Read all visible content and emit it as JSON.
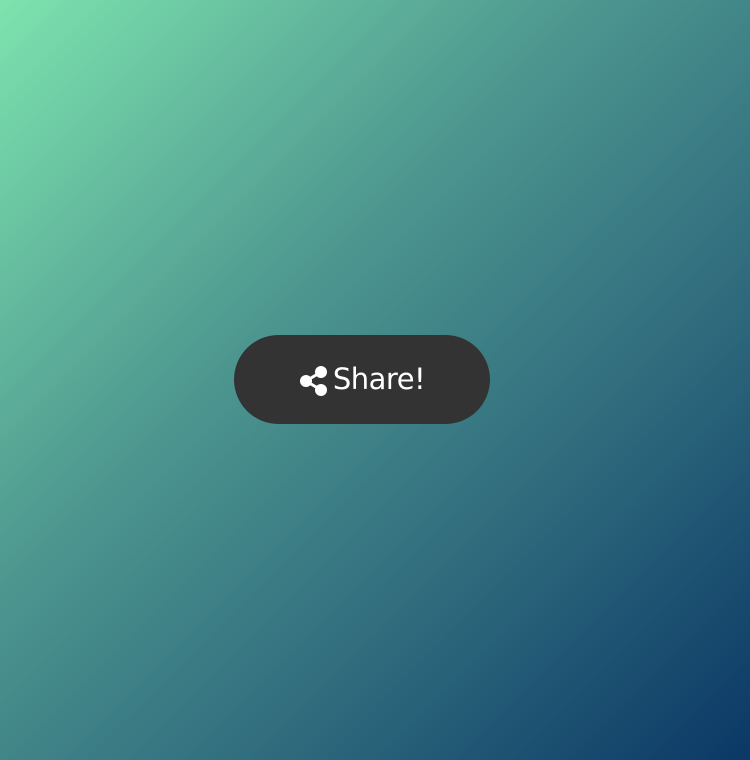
{
  "share_button": {
    "label": "Share!",
    "icon": "share-icon"
  },
  "colors": {
    "gradient_start": "#7de3ae",
    "gradient_end": "#0b3866",
    "button_bg": "#333333",
    "button_text": "#ffffff"
  }
}
